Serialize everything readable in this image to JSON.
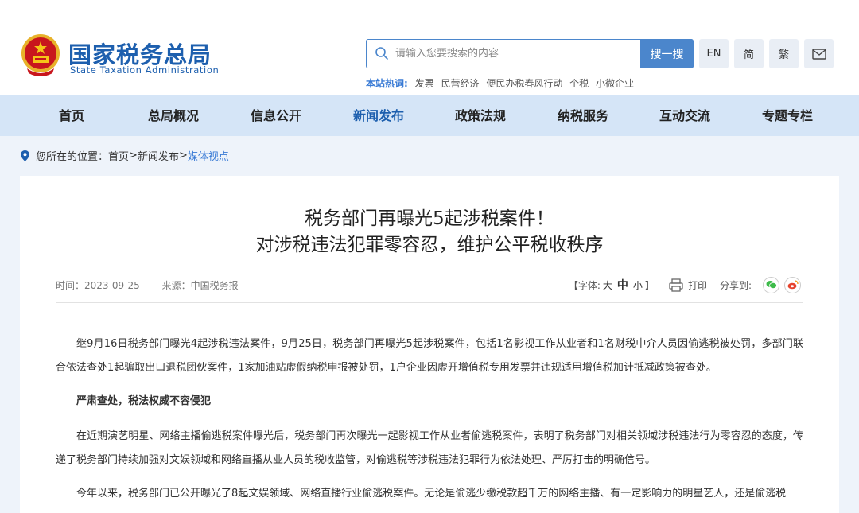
{
  "header": {
    "site_name_cn": "国家税务总局",
    "site_name_en": "State Taxation Administration",
    "search_placeholder": "请输入您要搜索的内容",
    "search_button": "搜一搜",
    "lang_en": "EN",
    "lang_simplified": "简",
    "lang_traditional": "繁",
    "hot_label": "本站热词:",
    "hot_words": [
      "发票",
      "民营经济",
      "便民办税春风行动",
      "个税",
      "小微企业"
    ]
  },
  "nav": [
    "首页",
    "总局概况",
    "信息公开",
    "新闻发布",
    "政策法规",
    "纳税服务",
    "互动交流",
    "专题专栏"
  ],
  "breadcrumb": {
    "label": "您所在的位置：",
    "home": "首页",
    "sep1": ">",
    "section": "新闻发布",
    "sep2": ">",
    "current": "媒体视点"
  },
  "article": {
    "title_line1": "税务部门再曝光5起涉税案件！",
    "title_line2": "对涉税违法犯罪零容忍，维护公平税收秩序",
    "date_label": "时间：",
    "date": "2023-09-25",
    "source_label": "来源：",
    "source": "中国税务报",
    "font_size_label": "【字体:",
    "font_large": "大",
    "font_medium": "中",
    "font_small": "小",
    "font_size_end": "】",
    "print_label": "打印",
    "share_label": "分享到:",
    "paragraphs": [
      "继9月16日税务部门曝光4起涉税违法案件，9月25日，税务部门再曝光5起涉税案件，包括1名影视工作从业者和1名财税中介人员因偷逃税被处罚，多部门联合依法查处1起骗取出口退税团伙案件，1家加油站虚假纳税申报被处罚，1户企业因虚开增值税专用发票并违规适用增值税加计抵减政策被查处。",
      "严肃查处，税法权威不容侵犯",
      "在近期演艺明星、网络主播偷逃税案件曝光后，税务部门再次曝光一起影视工作从业者偷逃税案件，表明了税务部门对相关领域涉税违法行为零容忍的态度，传递了税务部门持续加强对文娱领域和网络直播从业人员的税收监管，对偷逃税等涉税违法犯罪行为依法处理、严厉打击的明确信号。",
      "今年以来，税务部门已公开曝光了8起文娱领域、网络直播行业偷逃税案件。无论是偷逃少缴税款超千万的网络主播、有一定影响力的明星艺人，还是偷逃税"
    ]
  },
  "colors": {
    "brand_blue": "#1d5fae",
    "nav_bg": "#d5e5f7",
    "accent": "#4b86cc",
    "page_bg": "#eef3fa"
  }
}
